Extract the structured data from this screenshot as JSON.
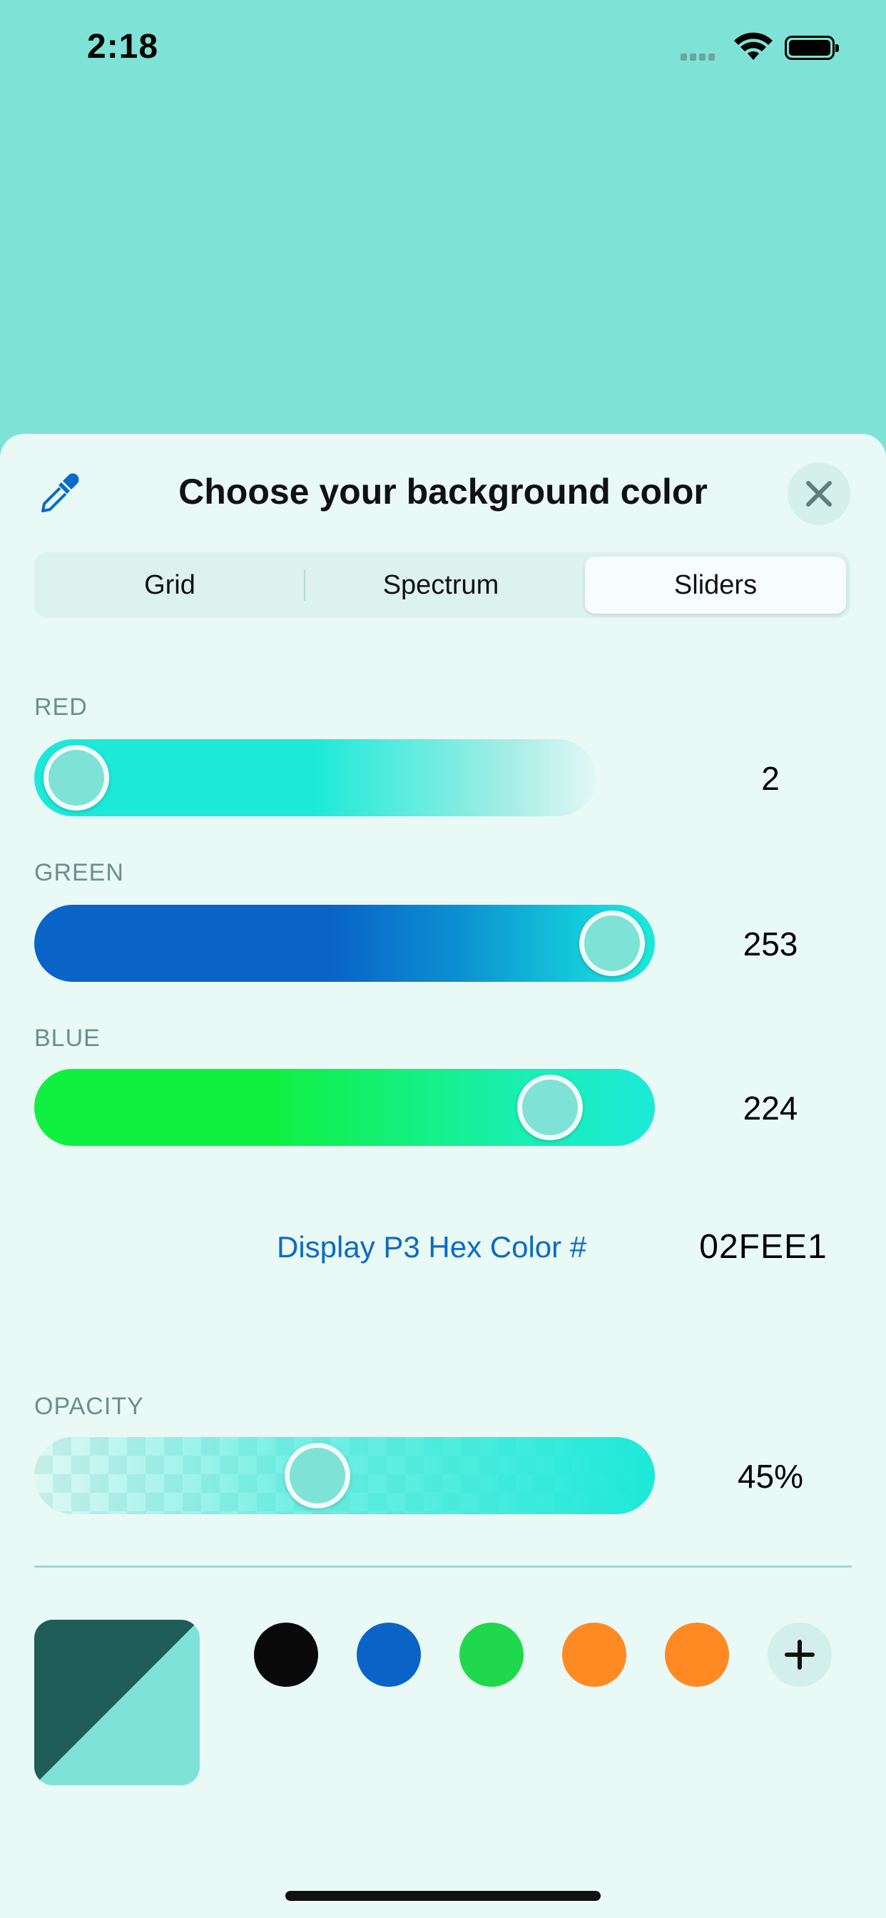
{
  "status_bar": {
    "time": "2:18"
  },
  "sheet": {
    "title": "Choose your background color",
    "icons": {
      "eyedropper": "eyedropper-icon",
      "close": "close-icon"
    }
  },
  "tabs": [
    {
      "label": "Grid",
      "selected": false
    },
    {
      "label": "Spectrum",
      "selected": false
    },
    {
      "label": "Sliders",
      "selected": true
    }
  ],
  "sliders": {
    "red": {
      "label": "RED",
      "value": "2",
      "fraction": 0.008
    },
    "green": {
      "label": "GREEN",
      "value": "253",
      "fraction": 0.992
    },
    "blue": {
      "label": "BLUE",
      "value": "224",
      "fraction": 0.878
    },
    "opacity": {
      "label": "OPACITY",
      "value": "45%",
      "fraction": 0.45
    }
  },
  "hex": {
    "label": "Display P3 Hex Color #",
    "value": "02FEE1"
  },
  "colors": {
    "accent": "#0a6bc8",
    "current": "#7fe2d6",
    "preview_dark": "#1f5d58",
    "swatches": [
      "#0a0a0a",
      "#0a64c8",
      "#1fd84c",
      "#ff8a24",
      "#ff8a24"
    ]
  }
}
